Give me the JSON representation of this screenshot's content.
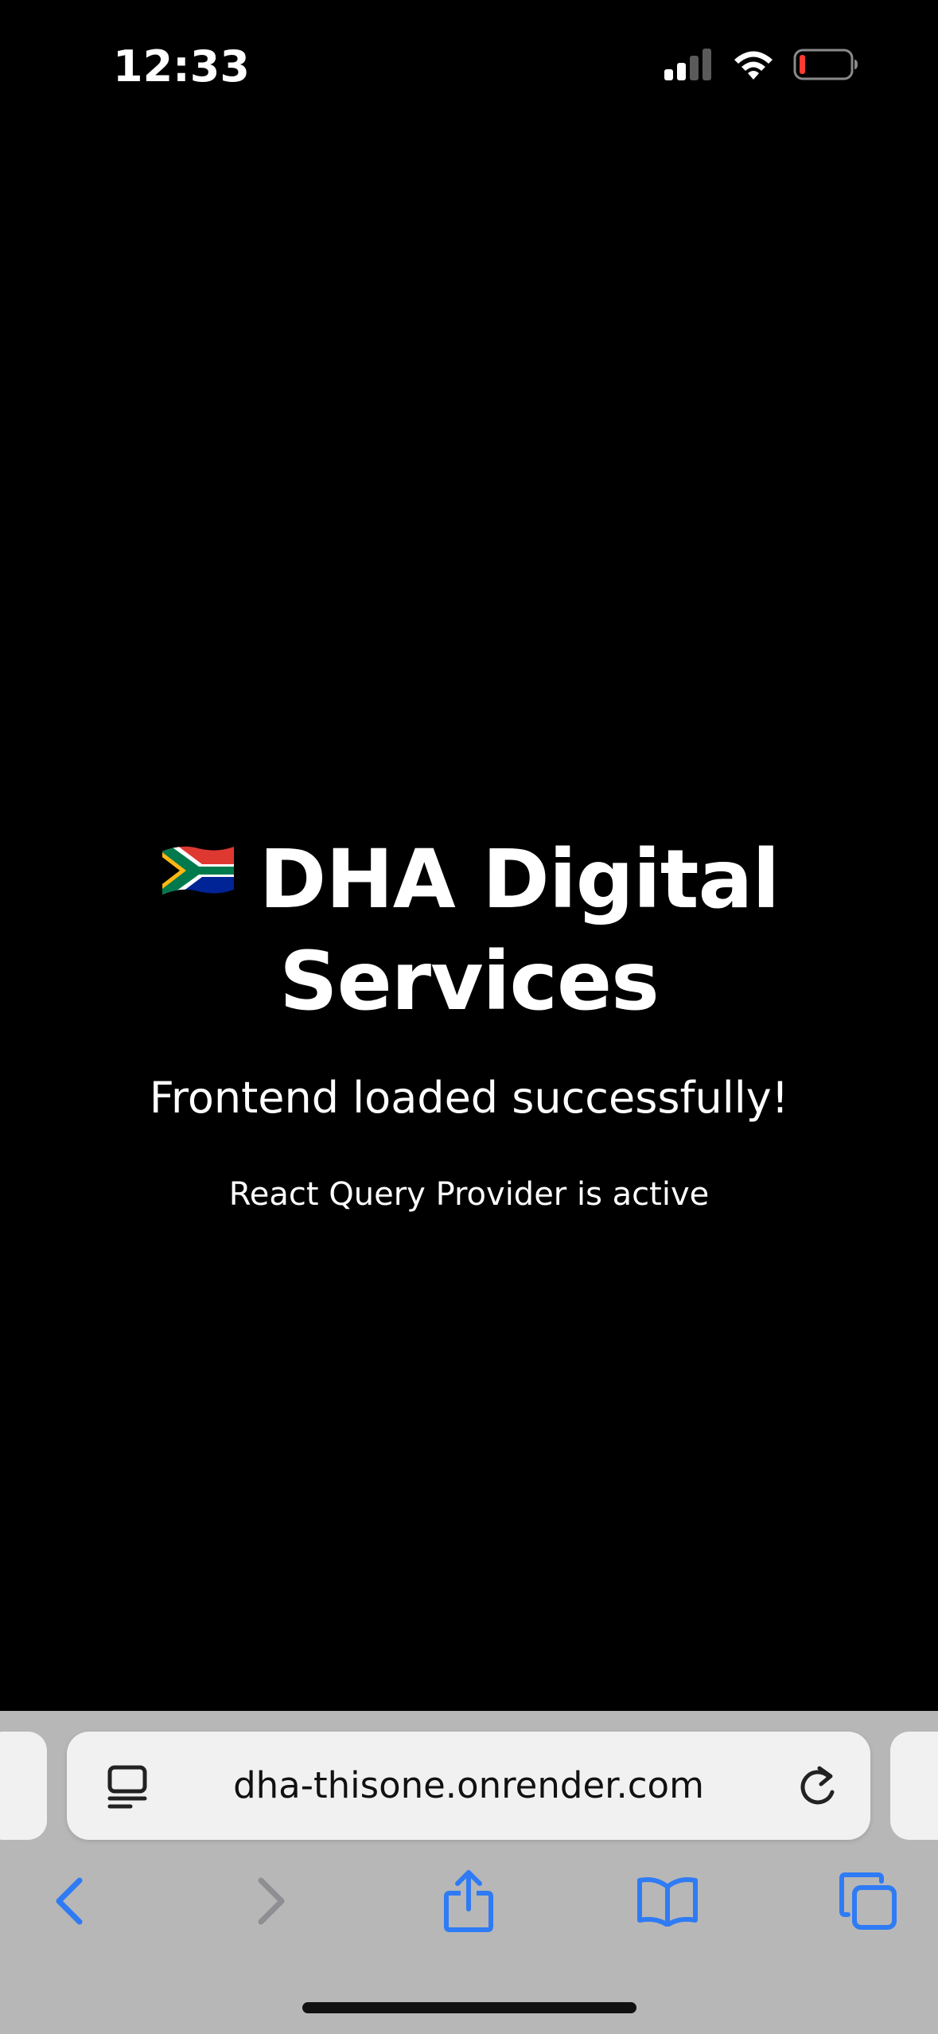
{
  "status_bar": {
    "time": "12:33"
  },
  "page": {
    "title": "DHA Digital Services",
    "title_line1": "DHA Digital",
    "title_line2": "Services",
    "flag_icon": "south-africa-flag-icon",
    "subtitle": "Frontend loaded successfully!",
    "status_text": "React Query Provider is active"
  },
  "browser": {
    "url": "dha-thisone.onrender.com",
    "toolbar": {
      "back_icon": "chevron-left-icon",
      "forward_icon": "chevron-right-icon",
      "share_icon": "share-icon",
      "bookmarks_icon": "book-icon",
      "tabs_icon": "tabs-icon"
    }
  },
  "colors": {
    "background": "#000000",
    "text": "#ffffff",
    "browser_chrome": "#b7b7b7",
    "address_bar": "#f1f1f1",
    "accent": "#2f7bf5",
    "disabled": "#8e8e93",
    "battery_low": "#ff3b30"
  }
}
